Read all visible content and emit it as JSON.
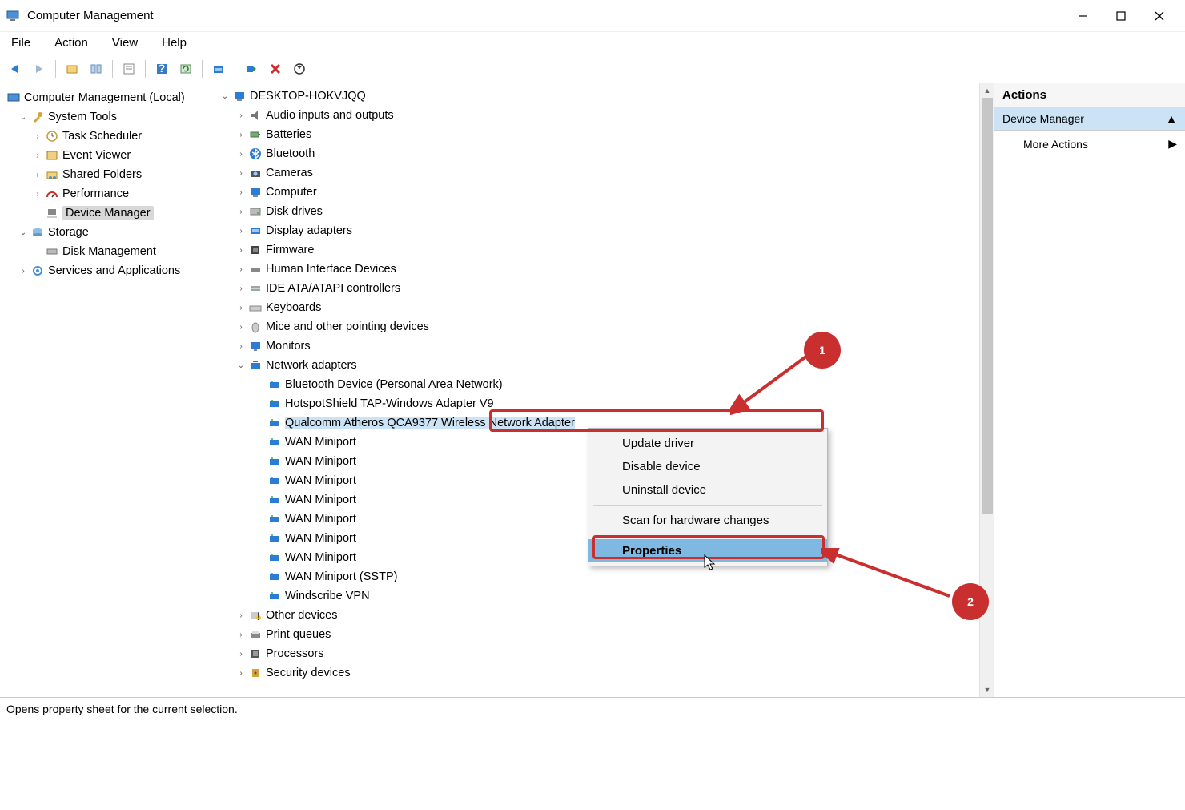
{
  "window": {
    "title": "Computer Management"
  },
  "menu": {
    "file": "File",
    "action": "Action",
    "view": "View",
    "help": "Help"
  },
  "statusbar": "Opens property sheet for the current selection.",
  "left_tree": {
    "root": "Computer Management (Local)",
    "items": [
      {
        "label": "System Tools",
        "indent": 1,
        "exp": "v",
        "children": [
          {
            "label": "Task Scheduler",
            "indent": 2,
            "exp": ">"
          },
          {
            "label": "Event Viewer",
            "indent": 2,
            "exp": ">"
          },
          {
            "label": "Shared Folders",
            "indent": 2,
            "exp": ">"
          },
          {
            "label": "Performance",
            "indent": 2,
            "exp": ">"
          },
          {
            "label": "Device Manager",
            "indent": 2,
            "exp": "",
            "selected": true
          }
        ]
      },
      {
        "label": "Storage",
        "indent": 1,
        "exp": "v",
        "children": [
          {
            "label": "Disk Management",
            "indent": 2,
            "exp": ""
          }
        ]
      },
      {
        "label": "Services and Applications",
        "indent": 1,
        "exp": ">"
      }
    ]
  },
  "device_tree": {
    "root": "DESKTOP-HOKVJQQ",
    "categories": [
      {
        "label": "Audio inputs and outputs",
        "exp": ">"
      },
      {
        "label": "Batteries",
        "exp": ">"
      },
      {
        "label": "Bluetooth",
        "exp": ">"
      },
      {
        "label": "Cameras",
        "exp": ">"
      },
      {
        "label": "Computer",
        "exp": ">"
      },
      {
        "label": "Disk drives",
        "exp": ">"
      },
      {
        "label": "Display adapters",
        "exp": ">"
      },
      {
        "label": "Firmware",
        "exp": ">"
      },
      {
        "label": "Human Interface Devices",
        "exp": ">"
      },
      {
        "label": "IDE ATA/ATAPI controllers",
        "exp": ">"
      },
      {
        "label": "Keyboards",
        "exp": ">"
      },
      {
        "label": "Mice and other pointing devices",
        "exp": ">"
      },
      {
        "label": "Monitors",
        "exp": ">"
      },
      {
        "label": "Network adapters",
        "exp": "v",
        "children": [
          "Bluetooth Device (Personal Area Network)",
          "HotspotShield TAP-Windows Adapter V9",
          "Qualcomm Atheros QCA9377 Wireless Network Adapter",
          "WAN Miniport",
          "WAN Miniport",
          "WAN Miniport",
          "WAN Miniport",
          "WAN Miniport",
          "WAN Miniport",
          "WAN Miniport",
          "WAN Miniport (SSTP)",
          "Windscribe VPN"
        ]
      },
      {
        "label": "Other devices",
        "exp": ">"
      },
      {
        "label": "Print queues",
        "exp": ">"
      },
      {
        "label": "Processors",
        "exp": ">"
      },
      {
        "label": "Security devices",
        "exp": ">"
      }
    ]
  },
  "context_menu": {
    "items": [
      "Update driver",
      "Disable device",
      "Uninstall device",
      "Scan for hardware changes",
      "Properties"
    ],
    "hover": "Properties"
  },
  "actions": {
    "head": "Actions",
    "selected": "Device Manager",
    "more": "More Actions"
  },
  "callouts": {
    "one": "1",
    "two": "2"
  }
}
